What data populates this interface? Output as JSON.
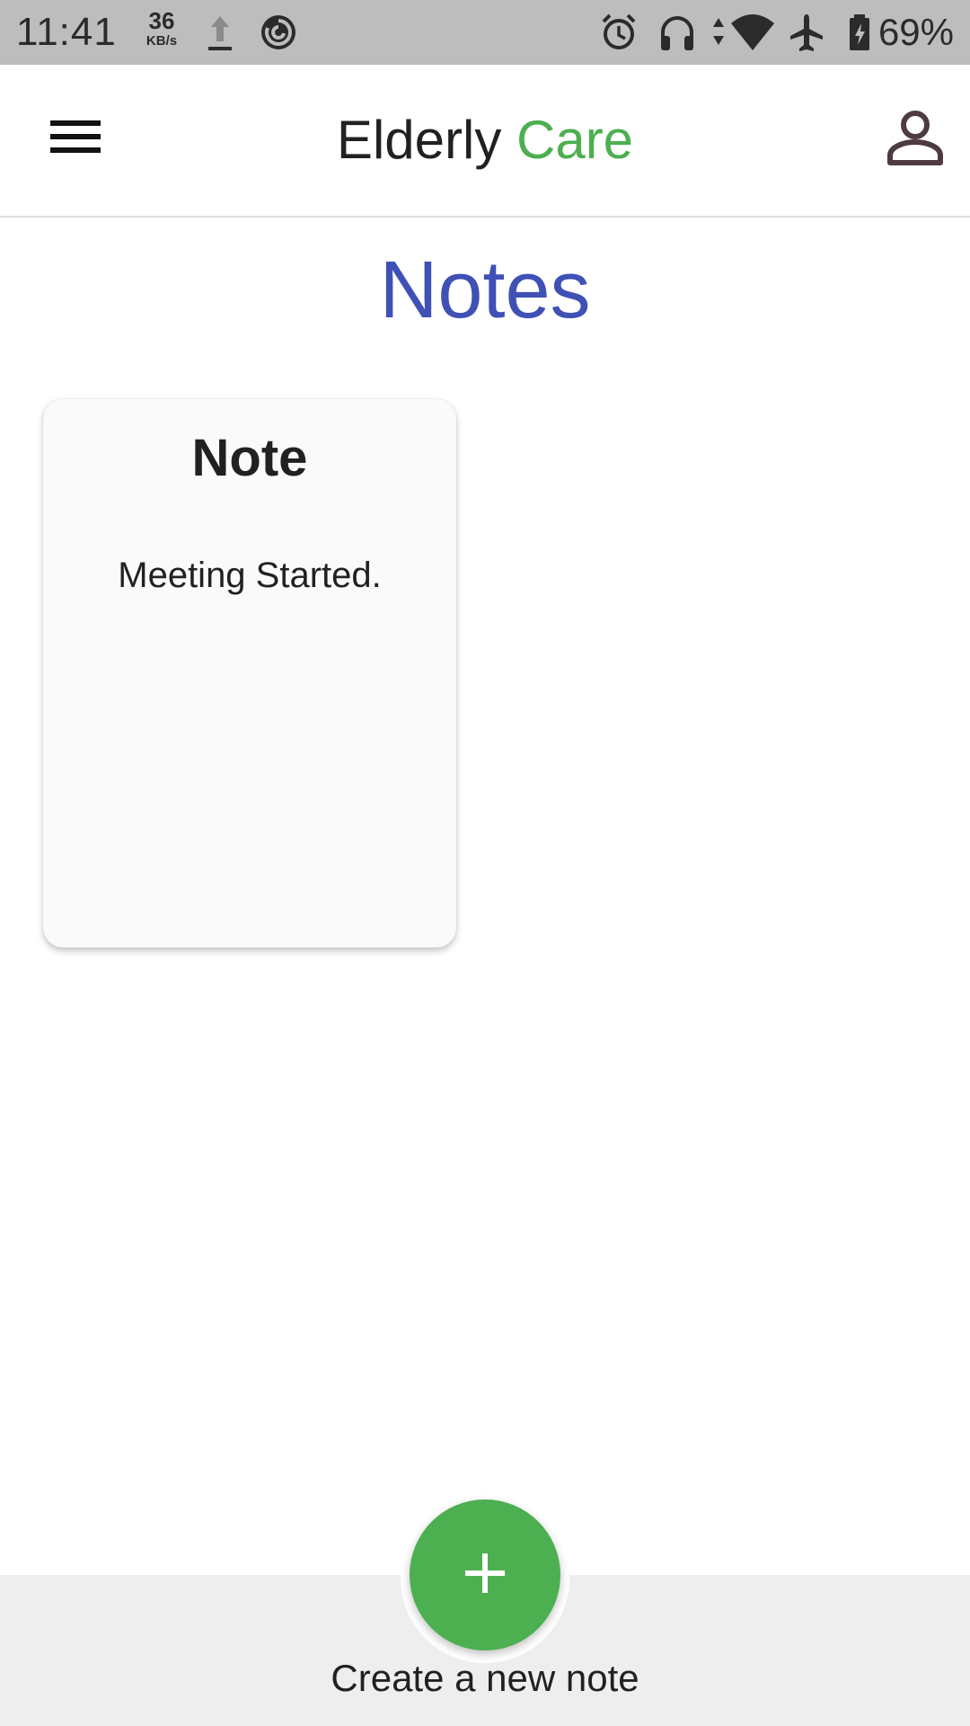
{
  "status_bar": {
    "time": "11:41",
    "net_speed_value": "36",
    "net_speed_unit": "KB/s",
    "battery_percent": "69%",
    "icons": [
      "upload-icon",
      "sync-app-icon",
      "alarm-icon",
      "headset-icon",
      "data-arrows-icon",
      "wifi-icon",
      "airplane-icon",
      "battery-charging-icon"
    ]
  },
  "app_bar": {
    "title_part1": "Elderly ",
    "title_part2": "Care",
    "menu_icon": "hamburger-menu-icon",
    "profile_icon": "person-icon"
  },
  "page": {
    "title": "Notes"
  },
  "notes": [
    {
      "title": "Note",
      "body": "Meeting Started."
    }
  ],
  "bottom": {
    "fab_icon": "plus-icon",
    "create_label": "Create a new note"
  },
  "colors": {
    "accent_green": "#4caf50",
    "title_blue": "#3f51b5",
    "status_bar_bg": "#bdbdbd",
    "bottom_bar_bg": "#eeeeee"
  }
}
